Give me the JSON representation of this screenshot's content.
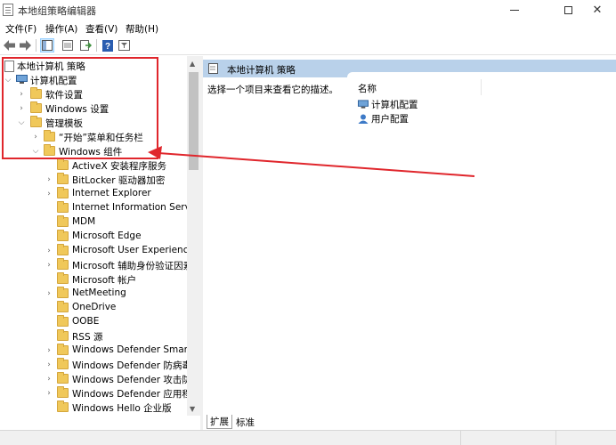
{
  "window": {
    "title": "本地组策略编辑器",
    "close_glyph": "✕"
  },
  "menu": {
    "items": [
      {
        "label": "文件(F)"
      },
      {
        "label": "操作(A)"
      },
      {
        "label": "查看(V)"
      },
      {
        "label": "帮助(H)"
      }
    ]
  },
  "toolbar": {
    "buttons": [
      "back-arrow-icon",
      "forward-arrow-icon",
      "show-tree-icon",
      "properties-icon",
      "export-list-icon",
      "help-icon",
      "filter-icon"
    ]
  },
  "tree": {
    "root": "本地计算机 策略",
    "computer_config": "计算机配置",
    "software_settings": "软件设置",
    "windows_settings": "Windows 设置",
    "admin_templates": "管理模板",
    "start_menu_taskbar": "“开始”菜单和任务栏",
    "windows_components": "Windows 组件",
    "components": [
      {
        "label": "ActiveX 安装程序服务",
        "expandable": false
      },
      {
        "label": "BitLocker 驱动器加密",
        "expandable": true
      },
      {
        "label": "Internet Explorer",
        "expandable": true
      },
      {
        "label": "Internet Information Service",
        "expandable": false
      },
      {
        "label": "MDM",
        "expandable": false
      },
      {
        "label": "Microsoft Edge",
        "expandable": false
      },
      {
        "label": "Microsoft User Experience V",
        "expandable": true
      },
      {
        "label": "Microsoft 辅助身份验证因素",
        "expandable": true
      },
      {
        "label": "Microsoft 帐户",
        "expandable": false
      },
      {
        "label": "NetMeeting",
        "expandable": true
      },
      {
        "label": "OneDrive",
        "expandable": false
      },
      {
        "label": "OOBE",
        "expandable": false
      },
      {
        "label": "RSS 源",
        "expandable": false
      },
      {
        "label": "Windows Defender SmartSc",
        "expandable": true
      },
      {
        "label": "Windows Defender 防病毒程",
        "expandable": true
      },
      {
        "label": "Windows Defender 攻击防护",
        "expandable": true
      },
      {
        "label": "Windows Defender 应用程序",
        "expandable": true
      },
      {
        "label": "Windows Hello 企业版",
        "expandable": false
      }
    ]
  },
  "right": {
    "header": "本地计算机 策略",
    "description": "选择一个项目来查看它的描述。",
    "column_name": "名称",
    "items": [
      {
        "label": "计算机配置"
      },
      {
        "label": "用户配置"
      }
    ]
  },
  "tabs": {
    "extended": "扩展",
    "standard": "标准"
  },
  "colors": {
    "annotation": "#e0262c",
    "header_bg": "#b9d1ea",
    "folder": "#f0c85a"
  }
}
